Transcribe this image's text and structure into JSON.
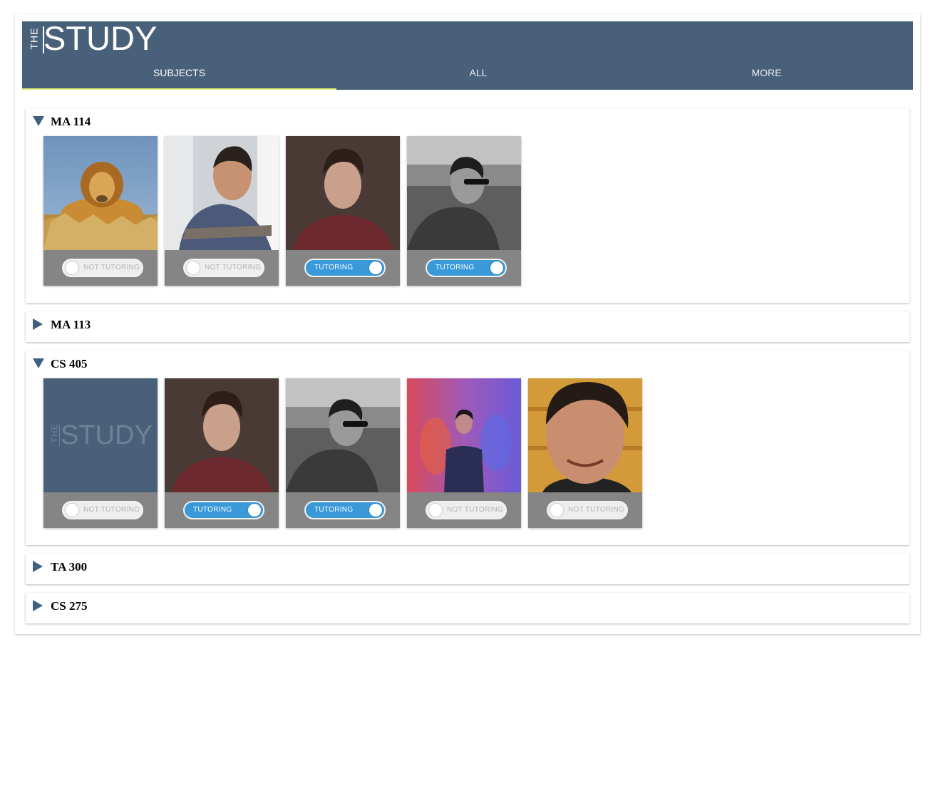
{
  "app": {
    "logo_the": "THE",
    "logo_study": "STUDY"
  },
  "tabs": [
    {
      "label": "SUBJECTS",
      "active": true
    },
    {
      "label": "ALL",
      "active": false
    },
    {
      "label": "MORE",
      "active": false
    }
  ],
  "colors": {
    "header": "#486079",
    "tab_indicator": "#e7ef7a",
    "toggle_on": "#3a9ad9",
    "card_footer": "#858585"
  },
  "subjects": [
    {
      "name": "MA 114",
      "expanded": true,
      "tutors": [
        {
          "photo": "lion-photo",
          "status": "NOT TUTORING",
          "tutoring": false
        },
        {
          "photo": "student-smiling-photo",
          "status": "NOT TUTORING",
          "tutoring": false
        },
        {
          "photo": "student-portrait-photo",
          "status": "TUTORING",
          "tutoring": true
        },
        {
          "photo": "student-sunglasses-bw-photo",
          "status": "TUTORING",
          "tutoring": true
        }
      ]
    },
    {
      "name": "MA 113",
      "expanded": false,
      "tutors": []
    },
    {
      "name": "CS 405",
      "expanded": true,
      "tutors": [
        {
          "photo": "the-study-logo-placeholder",
          "status": "NOT TUTORING",
          "tutoring": false,
          "placeholder_the": "THE",
          "placeholder_study": "STUDY"
        },
        {
          "photo": "student-portrait-photo",
          "status": "TUTORING",
          "tutoring": true
        },
        {
          "photo": "student-sunglasses-bw-photo",
          "status": "TUTORING",
          "tutoring": true
        },
        {
          "photo": "student-colored-lights-photo",
          "status": "NOT TUTORING",
          "tutoring": false
        },
        {
          "photo": "student-closeup-photo",
          "status": "NOT TUTORING",
          "tutoring": false
        }
      ]
    },
    {
      "name": "TA 300",
      "expanded": false,
      "tutors": []
    },
    {
      "name": "CS 275",
      "expanded": false,
      "tutors": []
    }
  ]
}
